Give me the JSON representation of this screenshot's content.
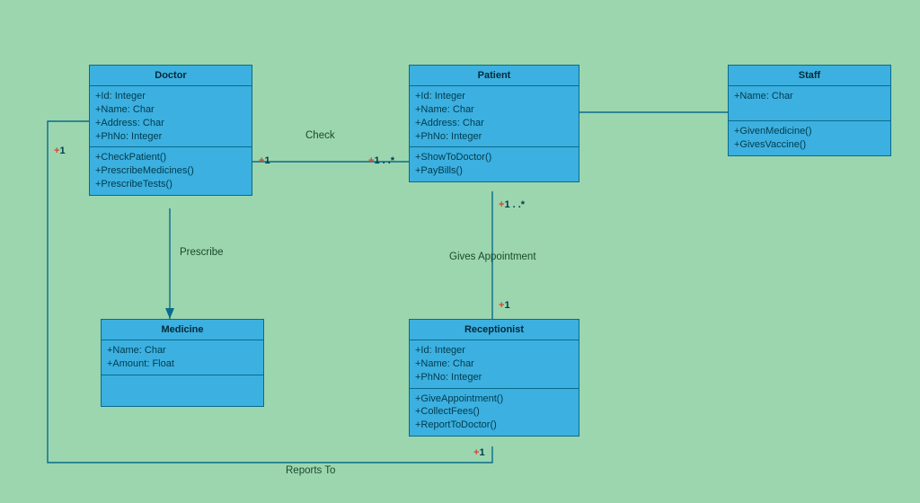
{
  "classes": {
    "doctor": {
      "title": "Doctor",
      "attrs": [
        "+Id: Integer",
        "+Name: Char",
        "+Address: Char",
        "+PhNo: Integer"
      ],
      "ops": [
        "+CheckPatient()",
        "+PrescribeMedicines()",
        "+PrescribeTests()"
      ]
    },
    "patient": {
      "title": "Patient",
      "attrs": [
        "+Id: Integer",
        "+Name: Char",
        "+Address: Char",
        "+PhNo: Integer"
      ],
      "ops": [
        "+ShowToDoctor()",
        "+PayBills()"
      ]
    },
    "staff": {
      "title": "Staff",
      "attrs": [
        "+Name: Char"
      ],
      "ops": [
        "+GivenMedicine()",
        "+GivesVaccine()"
      ]
    },
    "medicine": {
      "title": "Medicine",
      "attrs": [
        "+Name: Char",
        "+Amount: Float"
      ],
      "ops": []
    },
    "receptionist": {
      "title": "Receptionist",
      "attrs": [
        "+Id: Integer",
        "+Name: Char",
        "+PhNo: Integer"
      ],
      "ops": [
        "+GiveAppointment()",
        "+CollectFees()",
        "+ReportToDoctor()"
      ]
    }
  },
  "relations": {
    "check": {
      "label": "Check",
      "end_a": "+1",
      "end_b": "+1 . .*"
    },
    "prescribe": {
      "label": "Prescribe"
    },
    "givesAppointment": {
      "label": "Gives Appointment",
      "end_a": "+1 . .*",
      "end_b": "+1"
    },
    "reportsTo": {
      "label": "Reports To",
      "end_a": "+1",
      "end_b": "+1"
    },
    "patientStaff": {}
  }
}
